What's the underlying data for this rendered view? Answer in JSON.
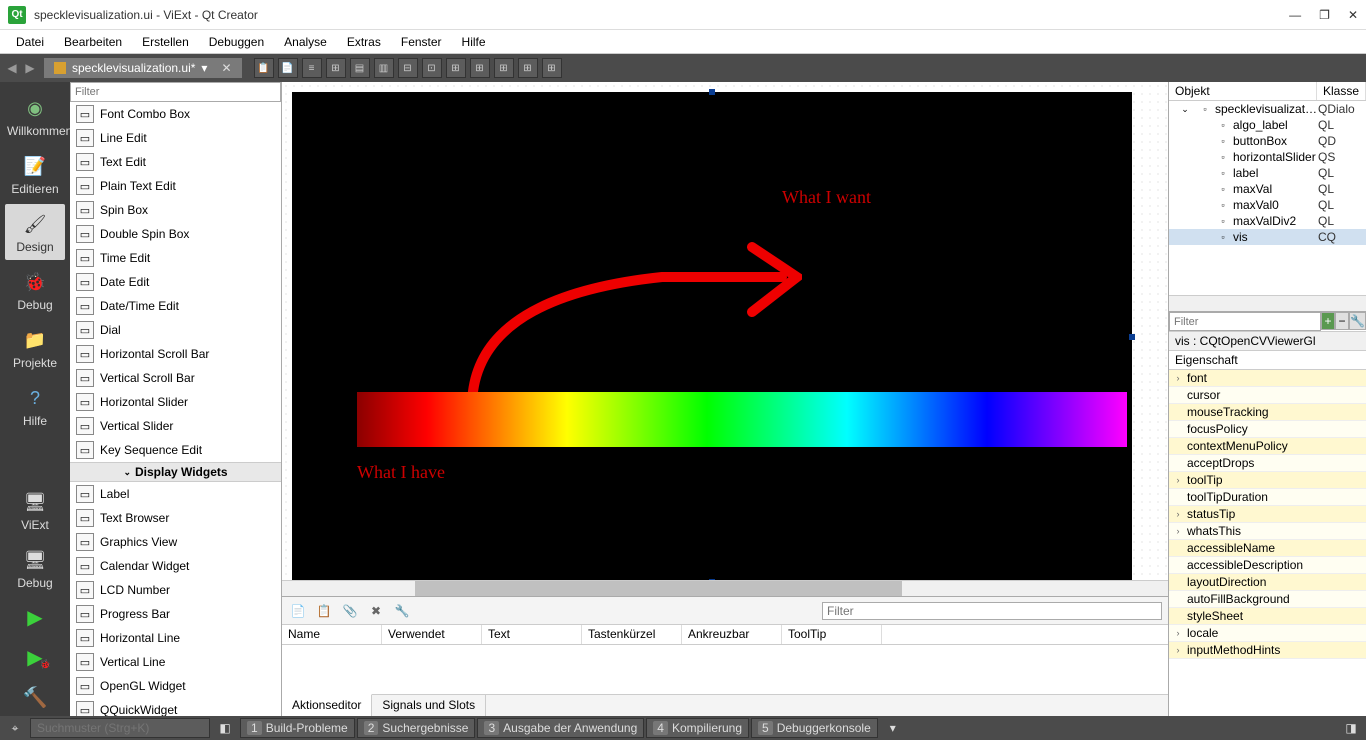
{
  "window": {
    "title": "specklevisualization.ui - ViExt - Qt Creator",
    "min": "—",
    "max": "❐",
    "close": "✕"
  },
  "menu": [
    "Datei",
    "Bearbeiten",
    "Erstellen",
    "Debuggen",
    "Analyse",
    "Extras",
    "Fenster",
    "Hilfe"
  ],
  "tab": {
    "name": "specklevisualization.ui*",
    "close": "✕"
  },
  "modes": [
    {
      "label": "Willkommen"
    },
    {
      "label": "Editieren"
    },
    {
      "label": "Design"
    },
    {
      "label": "Debug"
    },
    {
      "label": "Projekte"
    },
    {
      "label": "Hilfe"
    }
  ],
  "kit_label": "ViExt",
  "debug_label": "Debug",
  "widgetbox": {
    "filter_placeholder": "Filter",
    "items1": [
      "Font Combo Box",
      "Line Edit",
      "Text Edit",
      "Plain Text Edit",
      "Spin Box",
      "Double Spin Box",
      "Time Edit",
      "Date Edit",
      "Date/Time Edit",
      "Dial",
      "Horizontal Scroll Bar",
      "Vertical Scroll Bar",
      "Horizontal Slider",
      "Vertical Slider",
      "Key Sequence Edit"
    ],
    "category": "Display Widgets",
    "items2": [
      "Label",
      "Text Browser",
      "Graphics View",
      "Calendar Widget",
      "LCD Number",
      "Progress Bar",
      "Horizontal Line",
      "Vertical Line",
      "OpenGL Widget",
      "QQuickWidget"
    ]
  },
  "annotations": {
    "want": "What I want",
    "have": "What I have"
  },
  "actioneditor": {
    "filter_placeholder": "Filter",
    "cols": [
      "Name",
      "Verwendet",
      "Text",
      "Tastenkürzel",
      "Ankreuzbar",
      "ToolTip"
    ],
    "tabs": [
      "Aktionseditor",
      "Signals und Slots"
    ]
  },
  "objecttree": {
    "cols": [
      "Objekt",
      "Klasse"
    ],
    "rows": [
      {
        "indent": 0,
        "name": "specklevisualization",
        "klass": "QDialo",
        "exp": "⌄"
      },
      {
        "indent": 1,
        "name": "algo_label",
        "klass": "QL"
      },
      {
        "indent": 1,
        "name": "buttonBox",
        "klass": "QD"
      },
      {
        "indent": 1,
        "name": "horizontalSlider",
        "klass": "QS"
      },
      {
        "indent": 1,
        "name": "label",
        "klass": "QL"
      },
      {
        "indent": 1,
        "name": "maxVal",
        "klass": "QL"
      },
      {
        "indent": 1,
        "name": "maxVal0",
        "klass": "QL"
      },
      {
        "indent": 1,
        "name": "maxValDiv2",
        "klass": "QL"
      },
      {
        "indent": 1,
        "name": "vis",
        "klass": "CQ",
        "sel": true
      }
    ]
  },
  "properties": {
    "filter_placeholder": "Filter",
    "classline": "vis : CQtOpenCVViewerGl",
    "header": "Eigenschaft",
    "rows": [
      {
        "name": "font",
        "exp": true
      },
      {
        "name": "cursor"
      },
      {
        "name": "mouseTracking"
      },
      {
        "name": "focusPolicy"
      },
      {
        "name": "contextMenuPolicy"
      },
      {
        "name": "acceptDrops"
      },
      {
        "name": "toolTip",
        "exp": true
      },
      {
        "name": "toolTipDuration"
      },
      {
        "name": "statusTip",
        "exp": true
      },
      {
        "name": "whatsThis",
        "exp": true
      },
      {
        "name": "accessibleName"
      },
      {
        "name": "accessibleDescription"
      },
      {
        "name": "layoutDirection"
      },
      {
        "name": "autoFillBackground"
      },
      {
        "name": "styleSheet"
      },
      {
        "name": "locale",
        "exp": true
      },
      {
        "name": "inputMethodHints",
        "exp": true
      }
    ]
  },
  "status": {
    "search_placeholder": "Suchmuster (Strg+K)",
    "panes": [
      {
        "n": "1",
        "label": "Build-Probleme"
      },
      {
        "n": "2",
        "label": "Suchergebnisse"
      },
      {
        "n": "3",
        "label": "Ausgabe der Anwendung"
      },
      {
        "n": "4",
        "label": "Kompilierung"
      },
      {
        "n": "5",
        "label": "Debuggerkonsole"
      }
    ]
  }
}
